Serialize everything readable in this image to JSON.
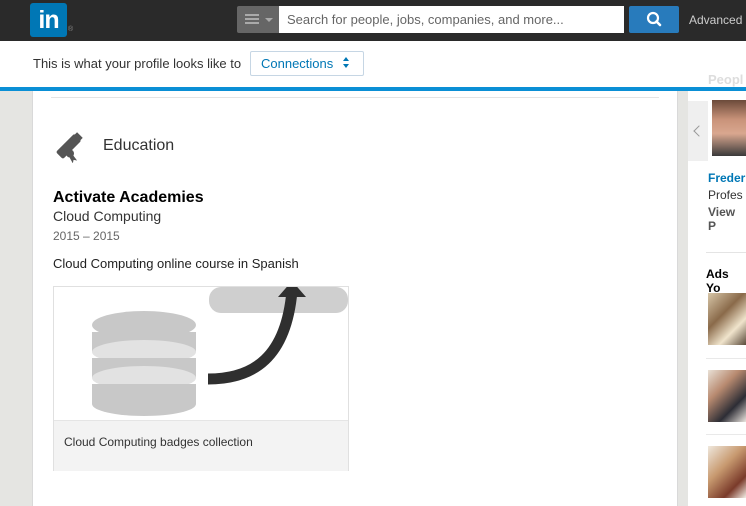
{
  "nav": {
    "logo_text": "in",
    "logo_reg": "®",
    "search_placeholder": "Search for people, jobs, companies, and more...",
    "advanced_label": "Advanced"
  },
  "profile_bar": {
    "text": "This is what your profile looks like to",
    "select_value": "Connections"
  },
  "education": {
    "heading": "Education",
    "school": "Activate Academies",
    "field": "Cloud Computing",
    "dates": "2015 – 2015",
    "description": "Cloud Computing online course in Spanish",
    "media_caption": "Cloud Computing badges collection"
  },
  "right_rail": {
    "people_heading": "Peopl",
    "person_name": "Freder",
    "person_title": "Profes",
    "person_view": "View P",
    "ads_heading": "Ads Yo"
  },
  "colors": {
    "brand": "#0077b5",
    "accent_bar": "#0a8fd5",
    "topbar": "#2a2a2a"
  }
}
